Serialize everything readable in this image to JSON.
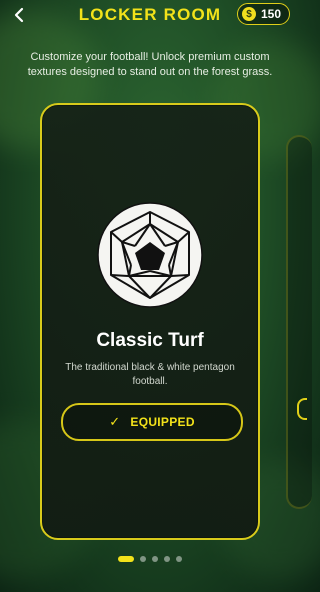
{
  "header": {
    "back_icon": "chevron-left-icon",
    "title": "LOCKER ROOM",
    "coin_symbol": "$",
    "coins": "150"
  },
  "subtitle": "Customize your football! Unlock premium custom textures designed to stand out on the forest grass.",
  "card": {
    "ball_icon": "soccer-ball-pentagon-icon",
    "name": "Classic Turf",
    "description": "The traditional black & white pentagon football.",
    "button_label": "EQUIPPED",
    "button_icon": "checkmark-icon"
  },
  "pager": {
    "count": 5,
    "active_index": 0
  },
  "colors": {
    "accent": "#f2e21a",
    "card_border": "#d8cb1b",
    "background_dark": "#12321a"
  }
}
